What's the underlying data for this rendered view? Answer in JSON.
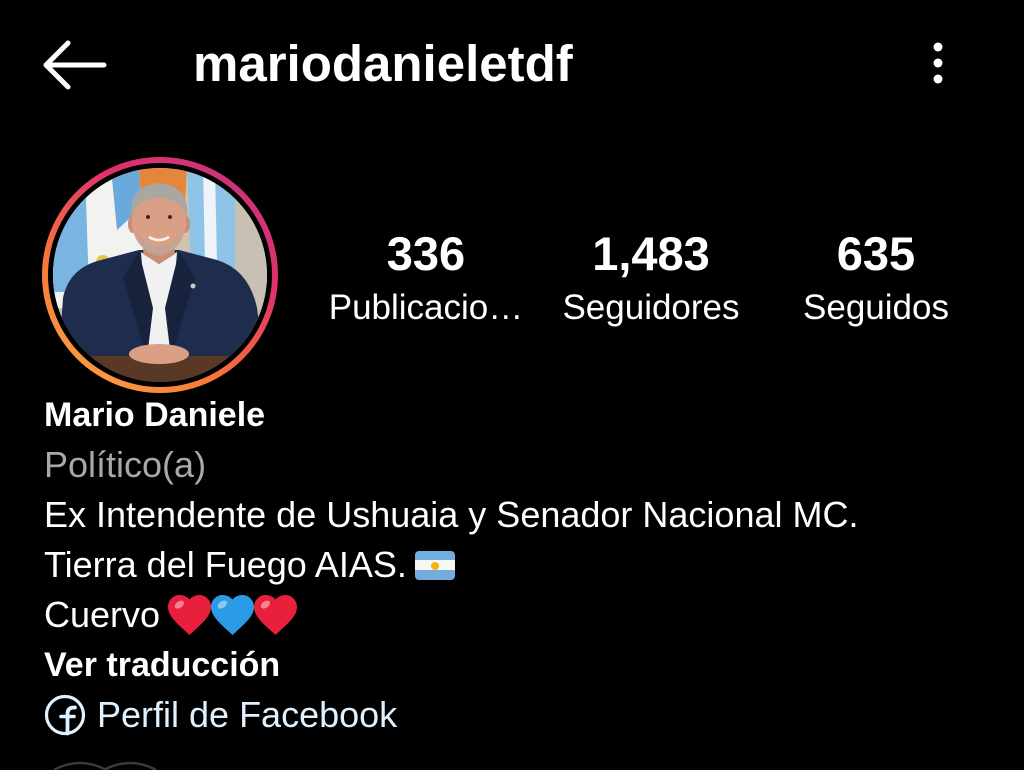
{
  "colors": {
    "background": "#000000",
    "text": "#ffffff",
    "muted_text": "#a8a8a8",
    "link_text": "#e0f1ff",
    "story_ring": [
      "#fcaf45",
      "#f77737",
      "#e1306c",
      "#c13584"
    ],
    "heart_red": "#e8203b",
    "heart_blue": "#2c9be6",
    "flag_blue": "#74acdf"
  },
  "header": {
    "back_icon": "arrow-left-icon",
    "username": "mariodanieletdf",
    "menu_icon": "more-vertical-icon"
  },
  "profile": {
    "stats": [
      {
        "value": "336",
        "label": "Publicacio…"
      },
      {
        "value": "1,483",
        "label": "Seguidores"
      },
      {
        "value": "635",
        "label": "Seguidos"
      }
    ]
  },
  "bio": {
    "name": "Mario Daniele",
    "category": "Político(a)",
    "line_1": "Ex Intendente de Ushuaia y Senador Nacional MC.",
    "line_2": "Tierra del Fuego AIAS.",
    "line_2_emoji": "argentina-flag-icon",
    "line_3": "Cuervo",
    "line_3_emojis": [
      "red-heart-icon",
      "blue-heart-icon",
      "red-heart-icon"
    ],
    "translate_link": "Ver traducción",
    "external_link": {
      "icon": "facebook-icon",
      "label": "Perfil de Facebook"
    }
  }
}
